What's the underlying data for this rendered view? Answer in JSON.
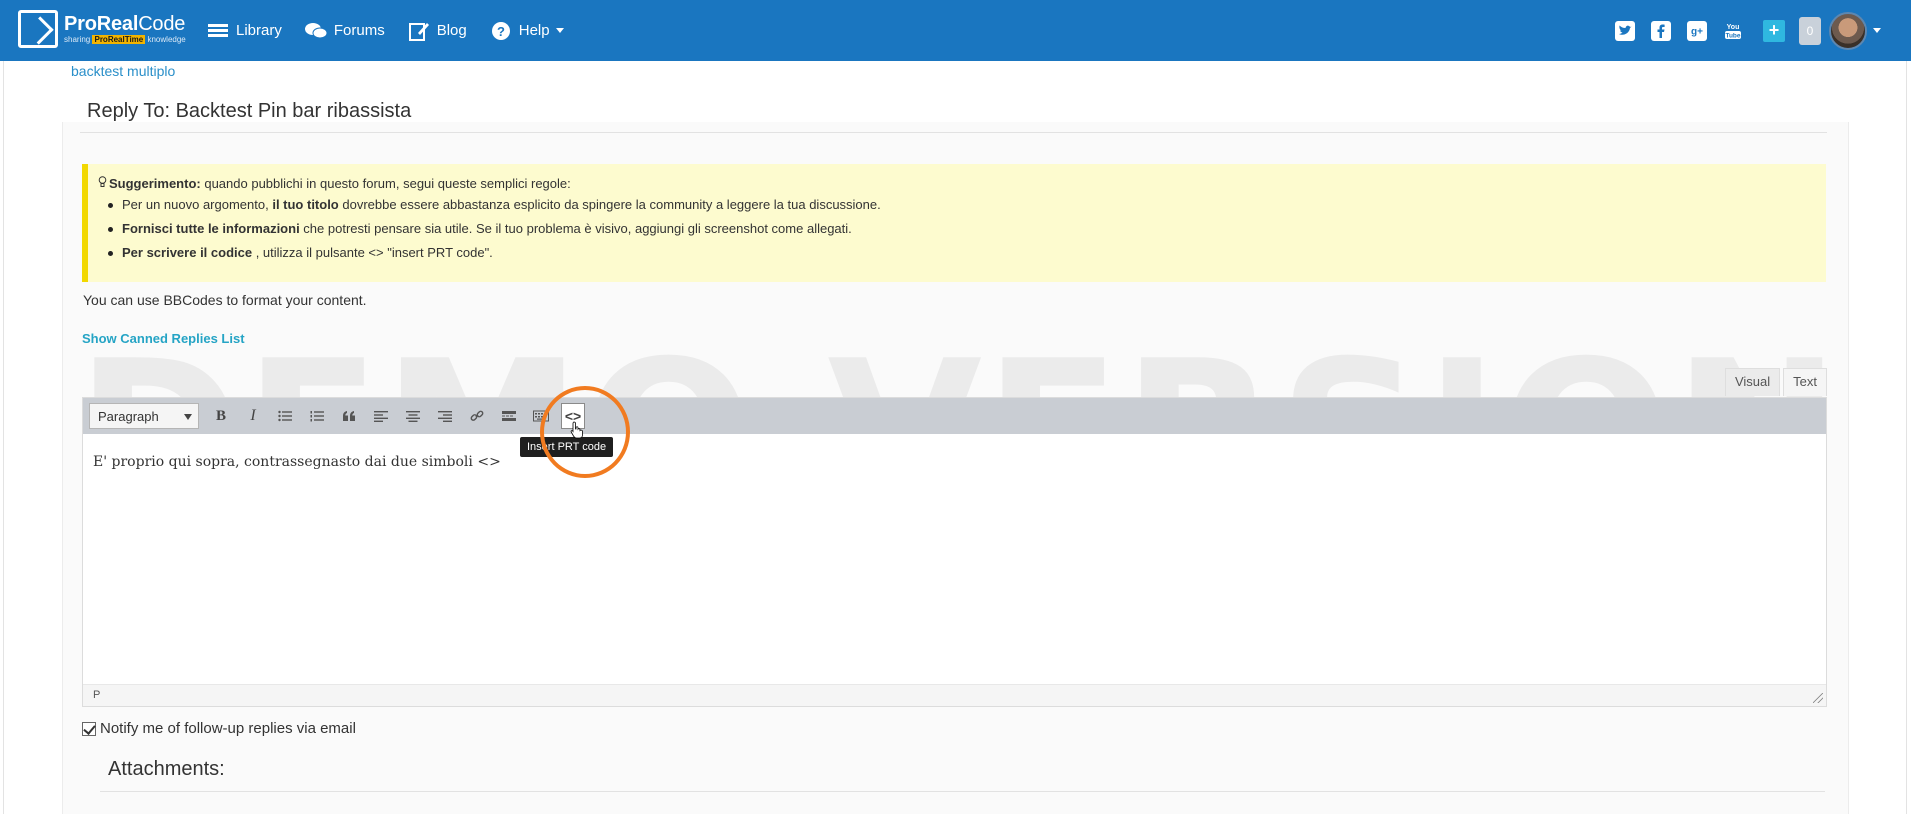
{
  "brand": {
    "name_bold": "ProReal",
    "name_light": "Code",
    "tagline_pre": "sharing",
    "tagline_brand": "ProRealTime",
    "tagline_post": "knowledge"
  },
  "nav": {
    "items": [
      {
        "label": "Library",
        "icon": "library-icon"
      },
      {
        "label": "Forums",
        "icon": "forums-icon"
      },
      {
        "label": "Blog",
        "icon": "blog-icon"
      },
      {
        "label": "Help",
        "icon": "help-icon"
      }
    ]
  },
  "header_right": {
    "notification_count": "0",
    "plus_label": "+"
  },
  "breadcrumb": {
    "link": "backtest multiplo"
  },
  "reply": {
    "title": "Reply To: Backtest Pin bar ribassista"
  },
  "hint": {
    "label": "Suggerimento:",
    "intro": " quando pubblichi in questo forum, segui queste semplici regole:",
    "items": [
      {
        "pre": "Per un nuovo argomento, ",
        "bold": "il tuo titolo",
        "post": " dovrebbe essere abbastanza esplicito da spingere la community a leggere la tua discussione."
      },
      {
        "pre": "",
        "bold": "Fornisci tutte le informazioni",
        "post": " che potresti pensare sia utile. Se il tuo problema è visivo, aggiungi gli screenshot come allegati."
      },
      {
        "pre": "",
        "bold": "Per scrivere il codice",
        "post": " , utilizza il pulsante <> \"insert PRT code\"."
      }
    ]
  },
  "bbcode_note": "You can use BBCodes to format your content.",
  "canned_link": "Show Canned Replies List",
  "editor": {
    "tabs": {
      "visual": "Visual",
      "text": "Text"
    },
    "format_select": "Paragraph",
    "toolbar": {
      "bold": "B",
      "italic": "I",
      "prt": "<>"
    },
    "content": "E' proprio qui sopra, contrassegnasto dai due simboli <>",
    "path": "P",
    "tooltip": "Insert PRT code"
  },
  "watermark": "DEMO VERSION",
  "notify_label": "Notify me of follow-up replies via email",
  "attachments_title": "Attachments:"
}
